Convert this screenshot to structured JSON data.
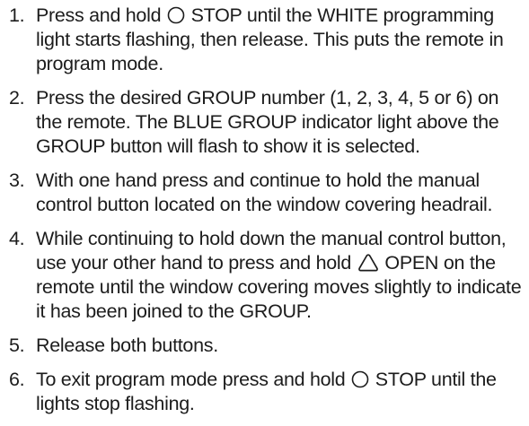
{
  "steps": [
    {
      "number": "1.",
      "before": "Press and hold ",
      "icon": "circle-icon",
      "after": " STOP until the WHITE programming light starts flashing, then release. This puts the remote in program mode."
    },
    {
      "number": "2.",
      "text": "Press the desired GROUP number (1, 2, 3, 4, 5 or 6) on the remote. The BLUE GROUP indicator light above the GROUP button will flash to show it is selected."
    },
    {
      "number": "3.",
      "text": "With one hand press and continue to hold the manual control button located on the window covering headrail."
    },
    {
      "number": "4.",
      "before": "While continuing to hold down the manual control button, use your other hand to press and hold ",
      "icon": "triangle-up-icon",
      "after": " OPEN on the remote until the window covering moves slightly to indicate it has been joined to the GROUP."
    },
    {
      "number": "5.",
      "text": "Release both buttons."
    },
    {
      "number": "6.",
      "before": "To exit program mode press and hold ",
      "icon": "circle-icon",
      "after": " STOP until the lights stop flashing."
    }
  ]
}
